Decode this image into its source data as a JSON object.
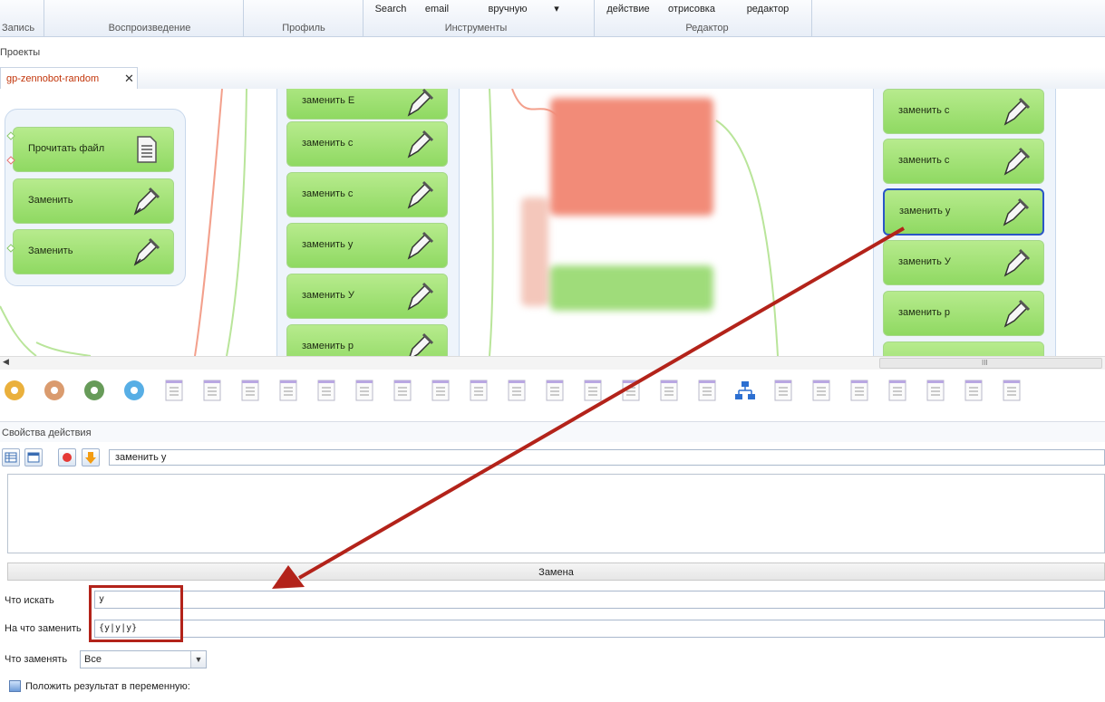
{
  "ribbon": {
    "groups": [
      {
        "label": "Запись"
      },
      {
        "label": "Воспроизведение"
      },
      {
        "label": "Профиль"
      },
      {
        "label": "Инструменты"
      },
      {
        "label": "Редактор"
      }
    ],
    "buttons": [
      {
        "label": "Search"
      },
      {
        "label": "email"
      },
      {
        "label": "вручную"
      },
      {
        "label": "действие"
      },
      {
        "label": "отрисовка"
      },
      {
        "label": "редактор"
      }
    ]
  },
  "projects_label": "Проекты",
  "tab": {
    "label": "gp-zennobot-random",
    "close": "✕"
  },
  "canvas": {
    "left_group": [
      "Прочитать файл",
      "Заменить",
      "Заменить"
    ],
    "mid_column": [
      "заменить Е",
      "заменить с",
      "заменить с",
      "заменить у",
      "заменить У",
      "заменить р"
    ],
    "right_column": [
      "заменить с",
      "заменить с",
      "заменить у",
      "заменить У",
      "заменить р"
    ],
    "selected_right_index": 2
  },
  "scroll_grip": "III",
  "props": {
    "title": "Свойства действия",
    "action_name": "заменить у",
    "section": "Замена",
    "find_label": "Что искать",
    "find_value": "у",
    "replace_label": "На что заменить",
    "replace_value": "{у|у|у}",
    "what_label": "Что заменять",
    "what_value": "Все",
    "checkbox_label": "Положить результат в переменную:"
  },
  "colors": {
    "accent": "#c2350a",
    "node_green": "#9be06f",
    "selection": "#2a56c6",
    "annotation": "#b3231a"
  }
}
